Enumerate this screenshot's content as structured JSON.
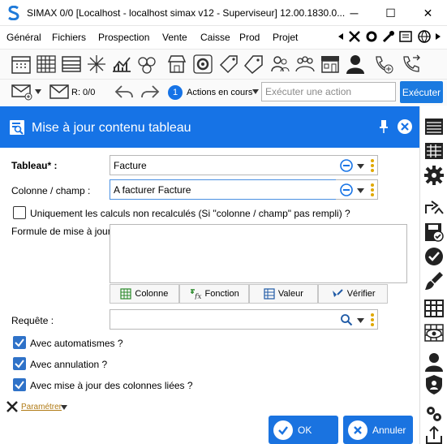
{
  "window": {
    "title": "SIMAX 0/0 [Localhost - localhost simax v12 - Superviseur] 12.00.1830.0...",
    "minimize": "─",
    "maximize": "☐",
    "close": "✕"
  },
  "menu": {
    "items": [
      "Général",
      "Fichiers",
      "Prospection",
      "Vente",
      "Caisse",
      "Prod",
      "Projet"
    ]
  },
  "toolbar2": {
    "mail_count": "R: 0/0",
    "actions_badge": "1",
    "actions_label": "Actions en cours",
    "search_placeholder": "Exécuter une action",
    "execute_label": "Exécuter"
  },
  "dialog": {
    "title": "Mise à jour contenu tableau",
    "tableau_label": "Tableau* :",
    "tableau_value": "Facture",
    "colonne_label": "Colonne / champ :",
    "colonne_value": "A facturer Facture",
    "uniquement_label": "Uniquement les calculs non recalculés (Si \"colonne / champ\" pas rempli) ?",
    "formule_label": "Formule de mise à jour :",
    "formule_buttons": [
      "Colonne",
      "Fonction",
      "Valeur",
      "Vérifier"
    ],
    "requete_label": "Requête :",
    "requete_value": "",
    "automatismes_label": "Avec automatismes ?",
    "annulation_label": "Avec annulation ?",
    "colonnes_liees_label": "Avec mise à jour des colonnes liées ?",
    "parametrer_label": "Paramétrer",
    "ok_label": "OK",
    "cancel_label": "Annuler"
  },
  "checkboxes": {
    "uniquement": false,
    "automatismes": true,
    "annulation": true,
    "colonnes_liees": true
  },
  "colors": {
    "accent": "#1673e6",
    "checkbox": "#2f72c8"
  }
}
